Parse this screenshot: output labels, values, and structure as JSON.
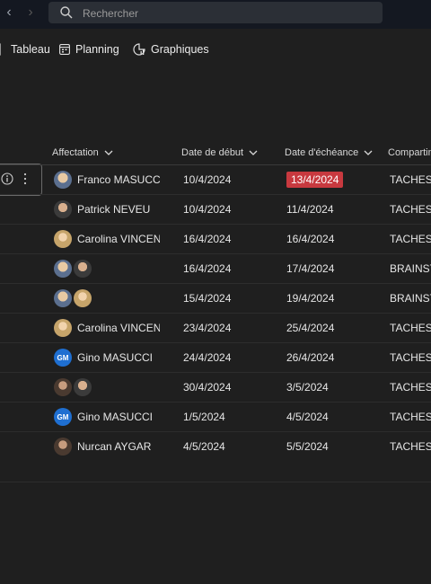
{
  "search": {
    "placeholder": "Rechercher"
  },
  "views": [
    {
      "label": "Tableau",
      "icon": "board-icon"
    },
    {
      "label": "Planning",
      "icon": "calendar-icon"
    },
    {
      "label": "Graphiques",
      "icon": "chart-icon"
    }
  ],
  "columns": {
    "assignee": "Affectation",
    "start": "Date de début",
    "due": "Date d'échéance",
    "bucket": "Compartim"
  },
  "colors": {
    "overdue": "#c8393f",
    "accent": "#1f6fd1"
  },
  "rows": [
    {
      "assignees": [
        {
          "name": "Franco MASUCCI",
          "avatar": "franco"
        }
      ],
      "name": "Franco MASUCCI",
      "start": "10/4/2024",
      "due": "13/4/2024",
      "due_overdue": true,
      "bucket": "TACHES E"
    },
    {
      "assignees": [
        {
          "name": "Patrick NEVEU",
          "avatar": "patrick"
        }
      ],
      "name": "Patrick NEVEU",
      "start": "10/4/2024",
      "due": "11/4/2024",
      "due_overdue": false,
      "bucket": "TACHES A"
    },
    {
      "assignees": [
        {
          "name": "Carolina VINCENZO",
          "avatar": "carolina"
        }
      ],
      "name": "Carolina VINCENZO",
      "start": "16/4/2024",
      "due": "16/4/2024",
      "due_overdue": false,
      "bucket": "TACHES A"
    },
    {
      "assignees": [
        {
          "avatar": "franco"
        },
        {
          "avatar": "patrick"
        }
      ],
      "name": "",
      "start": "16/4/2024",
      "due": "17/4/2024",
      "due_overdue": false,
      "bucket": "BRAINSTO"
    },
    {
      "assignees": [
        {
          "avatar": "franco"
        },
        {
          "avatar": "carolina"
        }
      ],
      "name": "",
      "start": "15/4/2024",
      "due": "19/4/2024",
      "due_overdue": false,
      "bucket": "BRAINSTO"
    },
    {
      "assignees": [
        {
          "name": "Carolina VINCENZO",
          "avatar": "carolina"
        }
      ],
      "name": "Carolina VINCENZO",
      "start": "23/4/2024",
      "due": "25/4/2024",
      "due_overdue": false,
      "bucket": "TACHES A"
    },
    {
      "assignees": [
        {
          "name": "Gino MASUCCI",
          "avatar": "gm",
          "initials": "GM"
        }
      ],
      "name": "Gino MASUCCI",
      "start": "24/4/2024",
      "due": "26/4/2024",
      "due_overdue": false,
      "bucket": "TACHES A"
    },
    {
      "assignees": [
        {
          "avatar": "nurcan"
        },
        {
          "avatar": "patrick"
        }
      ],
      "name": "",
      "start": "30/4/2024",
      "due": "3/5/2024",
      "due_overdue": false,
      "bucket": "TACHES E"
    },
    {
      "assignees": [
        {
          "name": "Gino MASUCCI",
          "avatar": "gm",
          "initials": "GM"
        }
      ],
      "name": "Gino MASUCCI",
      "start": "1/5/2024",
      "due": "4/5/2024",
      "due_overdue": false,
      "bucket": "TACHES A"
    },
    {
      "assignees": [
        {
          "name": "Nurcan AYGAR",
          "avatar": "nurcan"
        }
      ],
      "name": "Nurcan AYGAR",
      "start": "4/5/2024",
      "due": "5/5/2024",
      "due_overdue": false,
      "bucket": "TACHES A"
    }
  ]
}
